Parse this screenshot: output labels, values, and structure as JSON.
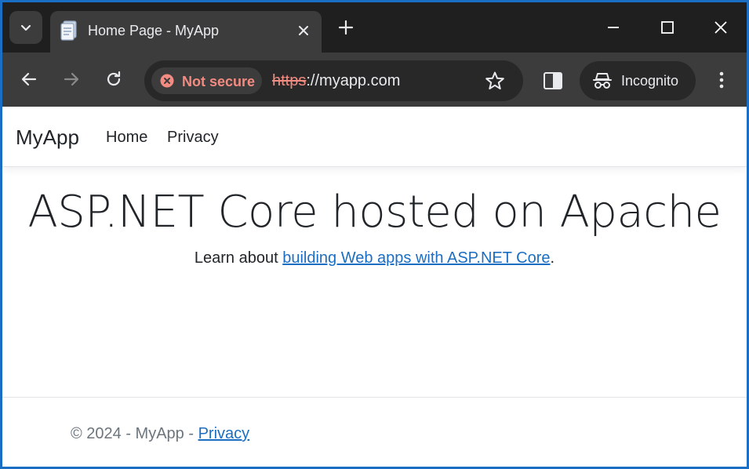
{
  "browser": {
    "tab": {
      "title": "Home Page - MyApp"
    },
    "security_chip": {
      "label": "Not secure"
    },
    "url": {
      "scheme": "https",
      "rest": "://myapp.com"
    },
    "incognito": {
      "label": "Incognito"
    },
    "icons": {
      "tab_search": "chevron-down-icon",
      "favicon": "document-icon",
      "close": "close-icon",
      "new_tab": "plus-icon",
      "minimize": "minimize-icon",
      "maximize": "maximize-icon",
      "window_close": "close-icon",
      "back": "arrow-left-icon",
      "forward": "arrow-right-icon",
      "reload": "reload-icon",
      "not_secure": "warning-circle-icon",
      "bookmark": "star-icon",
      "side_panel": "side-panel-icon",
      "incognito": "incognito-icon",
      "menu": "kebab-menu-icon"
    },
    "colors": {
      "chrome_dark": "#1f1f1f",
      "toolbar": "#3c3c3c",
      "not_secure": "#f28b82"
    }
  },
  "page": {
    "navbar": {
      "brand": "MyApp",
      "links": [
        {
          "label": "Home"
        },
        {
          "label": "Privacy"
        }
      ]
    },
    "main": {
      "headline": "ASP.NET Core hosted on Apache",
      "lead_prefix": "Learn about ",
      "lead_link": "building Web apps with ASP.NET Core",
      "lead_suffix": "."
    },
    "footer": {
      "text": "© 2024 - MyApp - ",
      "privacy_link": "Privacy"
    },
    "colors": {
      "link": "#1b6ec2",
      "text": "#212529",
      "muted": "#6c757d"
    }
  }
}
